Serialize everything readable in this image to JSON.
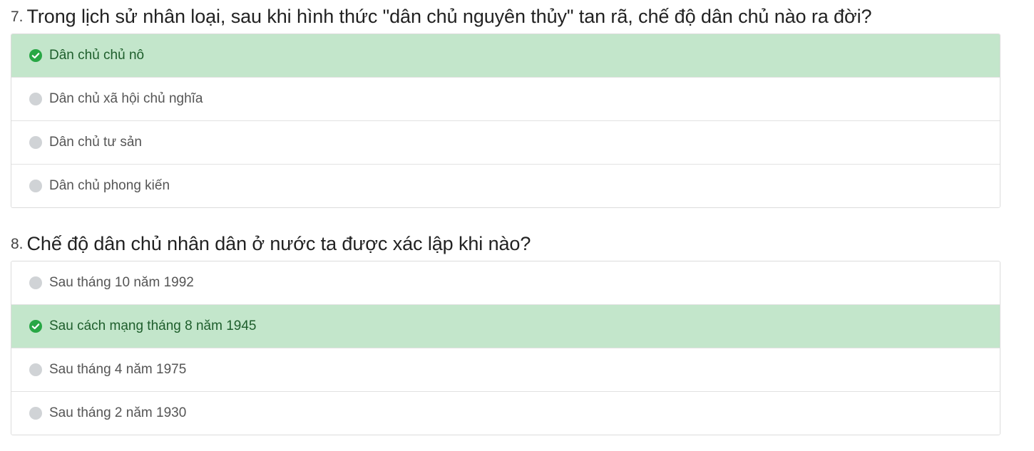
{
  "colors": {
    "correct_bg": "#c3e6cb",
    "correct_text": "#1e5e2c",
    "correct_icon": "#28a745",
    "radio": "#d0d3d6"
  },
  "questions": [
    {
      "number": "7.",
      "text": "Trong lịch sử nhân loại, sau khi hình thức \"dân chủ nguyên thủy\" tan rã, chế độ dân chủ nào ra đời?",
      "options": [
        {
          "label": "Dân chủ chủ nô",
          "correct": true,
          "icon": "check-circle-icon"
        },
        {
          "label": "Dân chủ xã hội chủ nghĩa",
          "correct": false,
          "icon": "radio-icon"
        },
        {
          "label": "Dân chủ tư sản",
          "correct": false,
          "icon": "radio-icon"
        },
        {
          "label": "Dân chủ phong kiến",
          "correct": false,
          "icon": "radio-icon"
        }
      ]
    },
    {
      "number": "8.",
      "text": "Chế độ dân chủ nhân dân ở nước ta được xác lập khi nào?",
      "options": [
        {
          "label": "Sau tháng 10 năm 1992",
          "correct": false,
          "icon": "radio-icon"
        },
        {
          "label": "Sau cách mạng tháng 8 năm 1945",
          "correct": true,
          "icon": "check-circle-icon"
        },
        {
          "label": "Sau tháng 4 năm 1975",
          "correct": false,
          "icon": "radio-icon"
        },
        {
          "label": "Sau tháng 2 năm 1930",
          "correct": false,
          "icon": "radio-icon"
        }
      ]
    }
  ]
}
